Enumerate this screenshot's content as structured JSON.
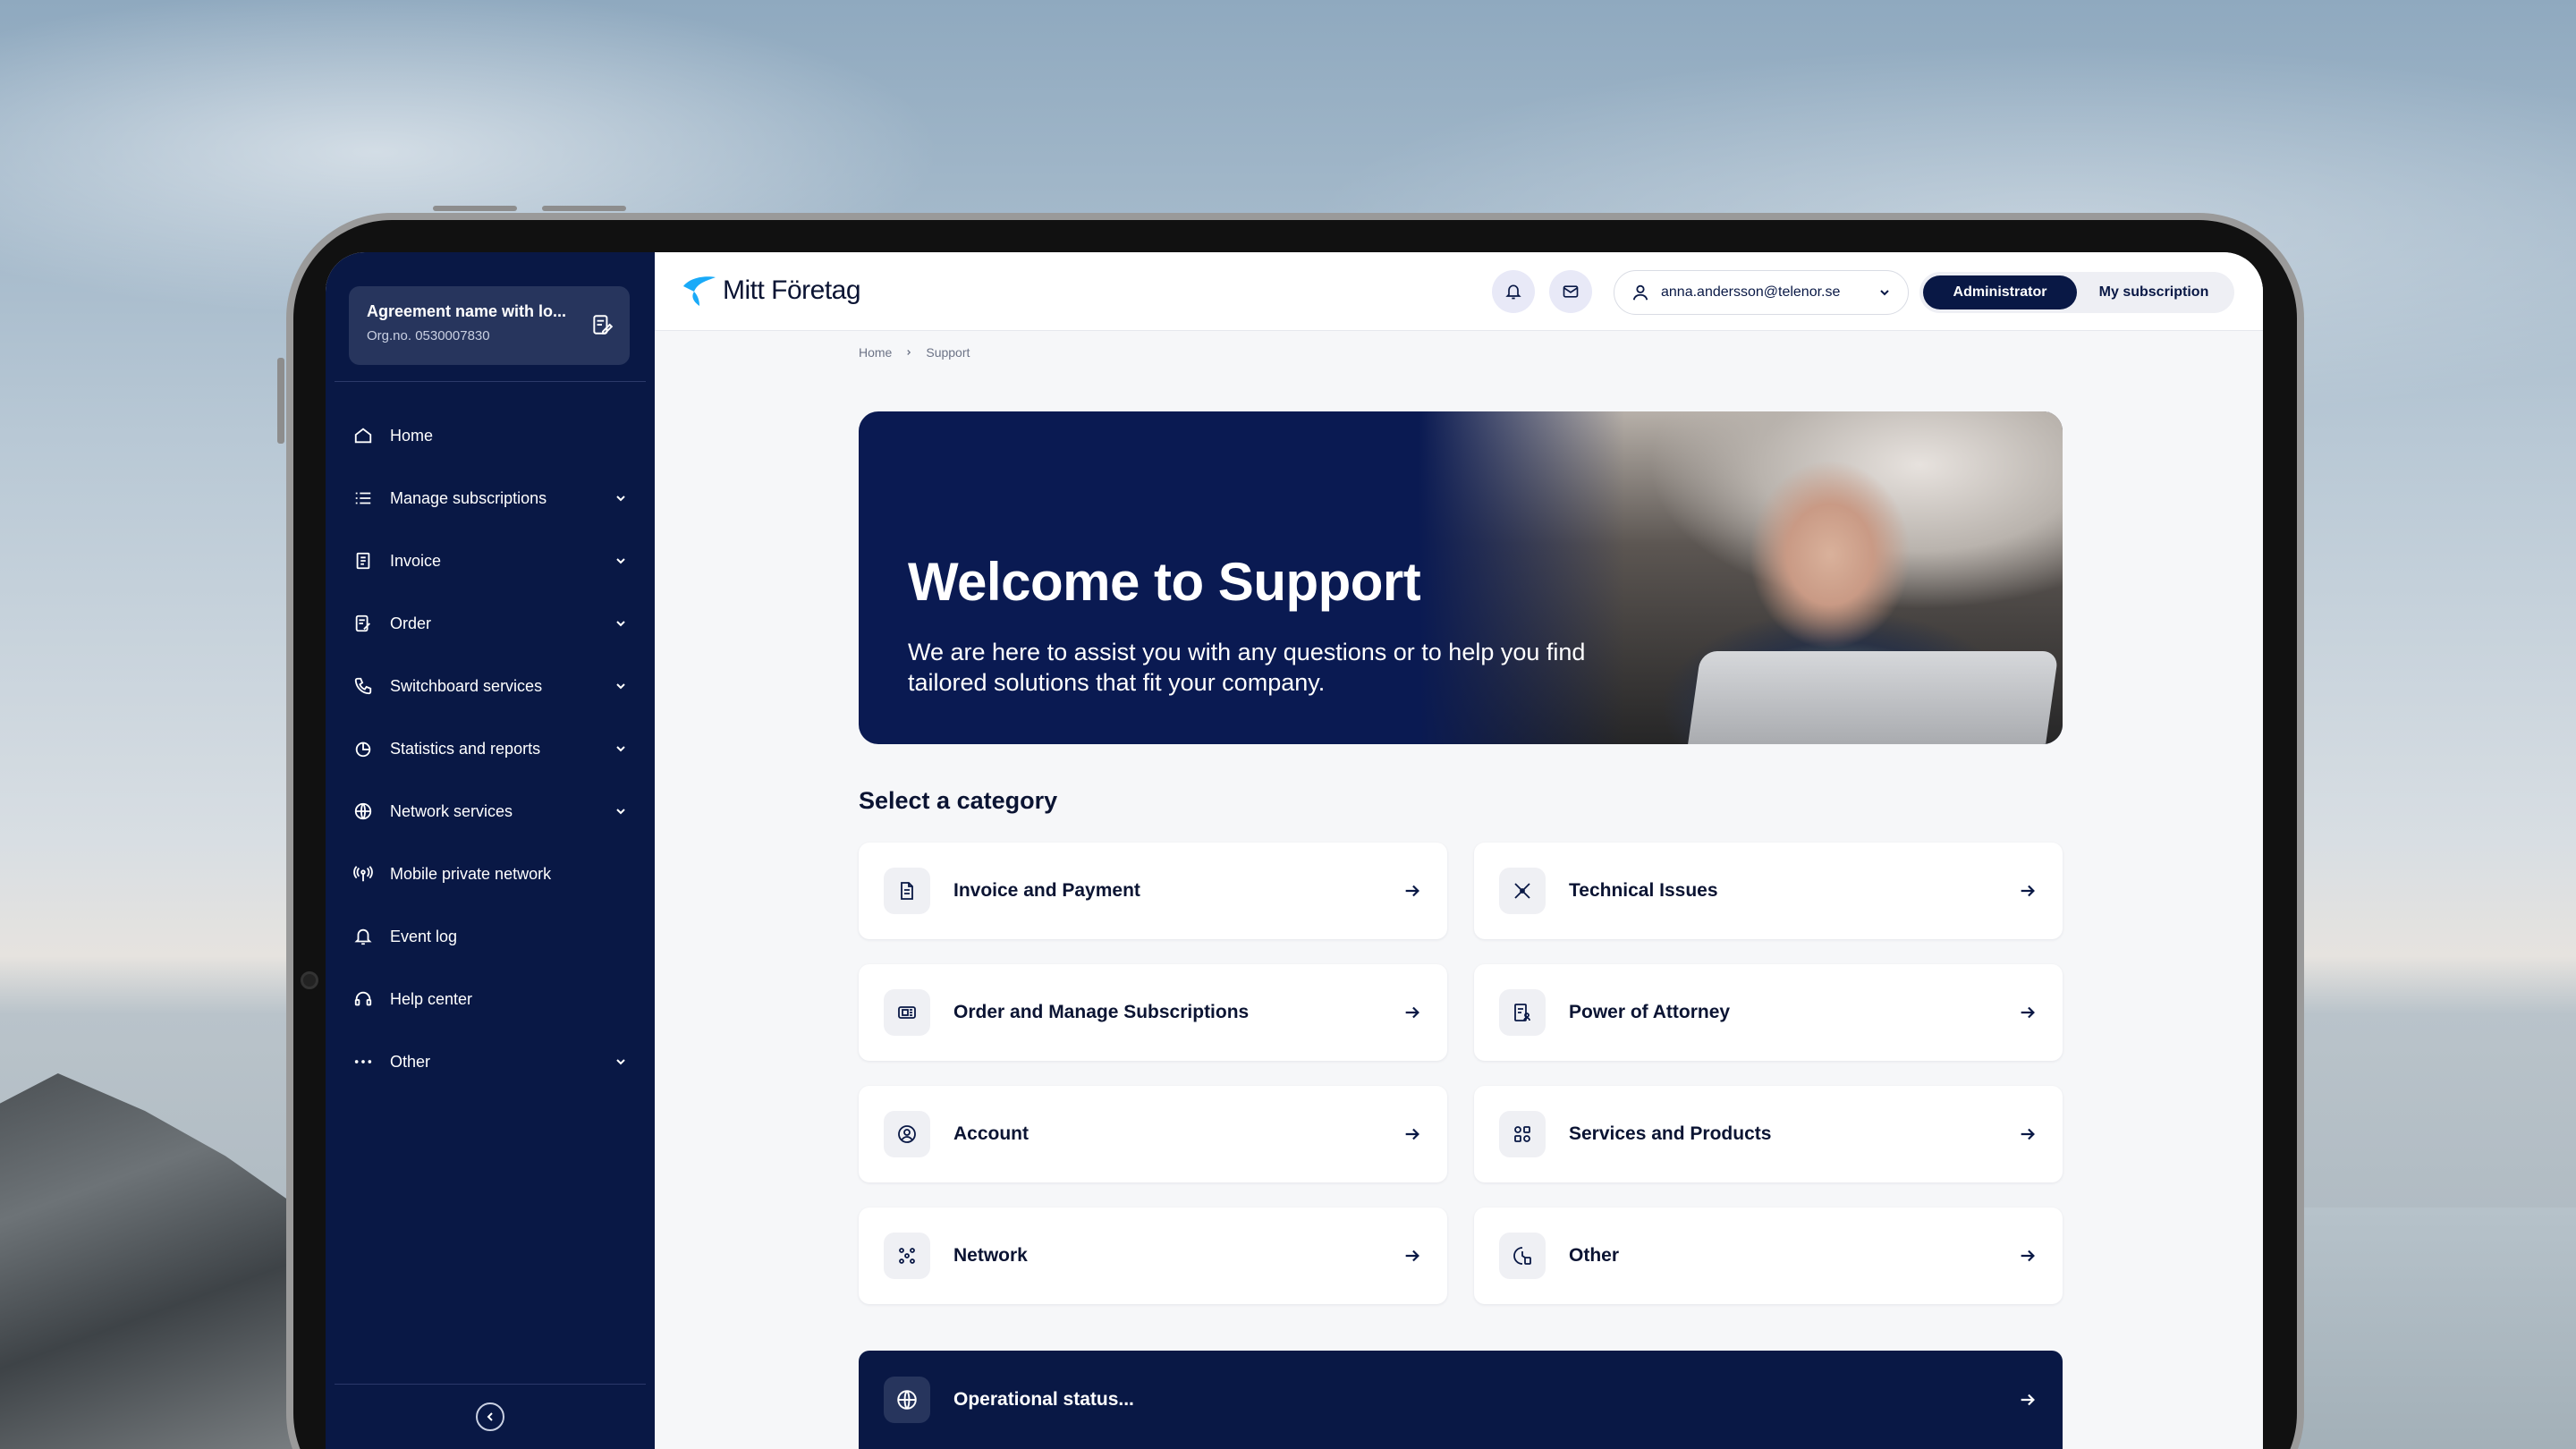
{
  "agreement": {
    "name": "Agreement name with lo...",
    "org": "Org.no. 0530007830"
  },
  "sidebar": {
    "items": [
      {
        "label": "Home",
        "icon": "home-icon",
        "expandable": false
      },
      {
        "label": "Manage subscriptions",
        "icon": "list-icon",
        "expandable": true
      },
      {
        "label": "Invoice",
        "icon": "invoice-icon",
        "expandable": true
      },
      {
        "label": "Order",
        "icon": "order-icon",
        "expandable": true
      },
      {
        "label": "Switchboard services",
        "icon": "phone-icon",
        "expandable": true
      },
      {
        "label": "Statistics and reports",
        "icon": "pie-chart-icon",
        "expandable": true
      },
      {
        "label": "Network services",
        "icon": "globe-icon",
        "expandable": true
      },
      {
        "label": "Mobile private network",
        "icon": "antenna-icon",
        "expandable": false
      },
      {
        "label": "Event log",
        "icon": "bell-icon",
        "expandable": false
      },
      {
        "label": "Help center",
        "icon": "headset-icon",
        "expandable": false
      },
      {
        "label": "Other",
        "icon": "more-icon",
        "expandable": true
      }
    ]
  },
  "header": {
    "brand": "Mitt Företag",
    "user_email": "anna.andersson@telenor.se",
    "role_active": "Administrator",
    "role_inactive": "My subscription"
  },
  "breadcrumb": {
    "home": "Home",
    "current": "Support"
  },
  "hero": {
    "title": "Welcome to Support",
    "text": "We are here to assist you with any questions or to help you find tailored solutions that fit your company."
  },
  "section_title": "Select a category",
  "categories": [
    {
      "label": "Invoice and Payment",
      "icon": "document-icon"
    },
    {
      "label": "Technical Issues",
      "icon": "tools-icon"
    },
    {
      "label": "Order and Manage Subscriptions",
      "icon": "sim-card-icon"
    },
    {
      "label": "Power of Attorney",
      "icon": "attorney-icon"
    },
    {
      "label": "Account",
      "icon": "user-circle-icon"
    },
    {
      "label": "Services and Products",
      "icon": "services-icon"
    },
    {
      "label": "Network",
      "icon": "network-icon"
    },
    {
      "label": "Other",
      "icon": "other-icon"
    }
  ],
  "operational_status": {
    "label": "Operational status...",
    "icon": "globe-icon"
  },
  "colors": {
    "navy": "#091845",
    "accent": "#19aaf8",
    "card_icon_bg": "#eff0f4"
  }
}
